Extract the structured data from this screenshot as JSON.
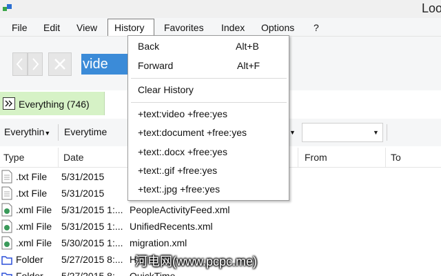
{
  "window": {
    "title": "Loo"
  },
  "menubar": {
    "file": "File",
    "edit": "Edit",
    "view": "View",
    "history": "History",
    "favorites": "Favorites",
    "index": "Index",
    "options": "Options",
    "help": "?"
  },
  "toolbar": {
    "search_value": "vide"
  },
  "breadcrumb": {
    "label": "Everything (746)"
  },
  "filters": {
    "type": "Everythin",
    "date": "Everytime"
  },
  "columns": {
    "type": "Type",
    "date": "Date",
    "from": "From",
    "to": "To"
  },
  "rows": [
    {
      "type": ".txt File",
      "date": "5/31/2015",
      "name": "",
      "icon": "text-file-icon"
    },
    {
      "type": ".txt File",
      "date": "5/31/2015",
      "name": "",
      "icon": "text-file-icon"
    },
    {
      "type": ".xml File",
      "date": "5/31/2015 1:...",
      "name": "PeopleActivityFeed.xml",
      "icon": "xml-file-icon"
    },
    {
      "type": ".xml File",
      "date": "5/31/2015 1:...",
      "name": "UnifiedRecents.xml",
      "icon": "xml-file-icon"
    },
    {
      "type": ".xml File",
      "date": "5/30/2015 1:...",
      "name": "migration.xml",
      "icon": "xml-file-icon"
    },
    {
      "type": "Folder",
      "date": "5/27/2015 8:...",
      "name": "H",
      "icon": "folder-icon"
    },
    {
      "type": "Folder",
      "date": "5/27/2015 8:...",
      "name": "QuickTime",
      "icon": "folder-icon"
    }
  ],
  "history_menu": {
    "back": "Back",
    "back_shortcut": "Alt+B",
    "forward": "Forward",
    "forward_shortcut": "Alt+F",
    "clear": "Clear History",
    "entries": [
      "+text:video +free:yes",
      "+text:document +free:yes",
      "+text:.docx +free:yes",
      "+text:.gif +free:yes",
      "+text:.jpg +free:yes"
    ]
  },
  "watermark": "河电网(www.pcpc.me)",
  "colors": {
    "selection": "#3b8bd8",
    "breadcrumb_bg": "#d6f2c6",
    "folder": "#2a4fd8"
  }
}
